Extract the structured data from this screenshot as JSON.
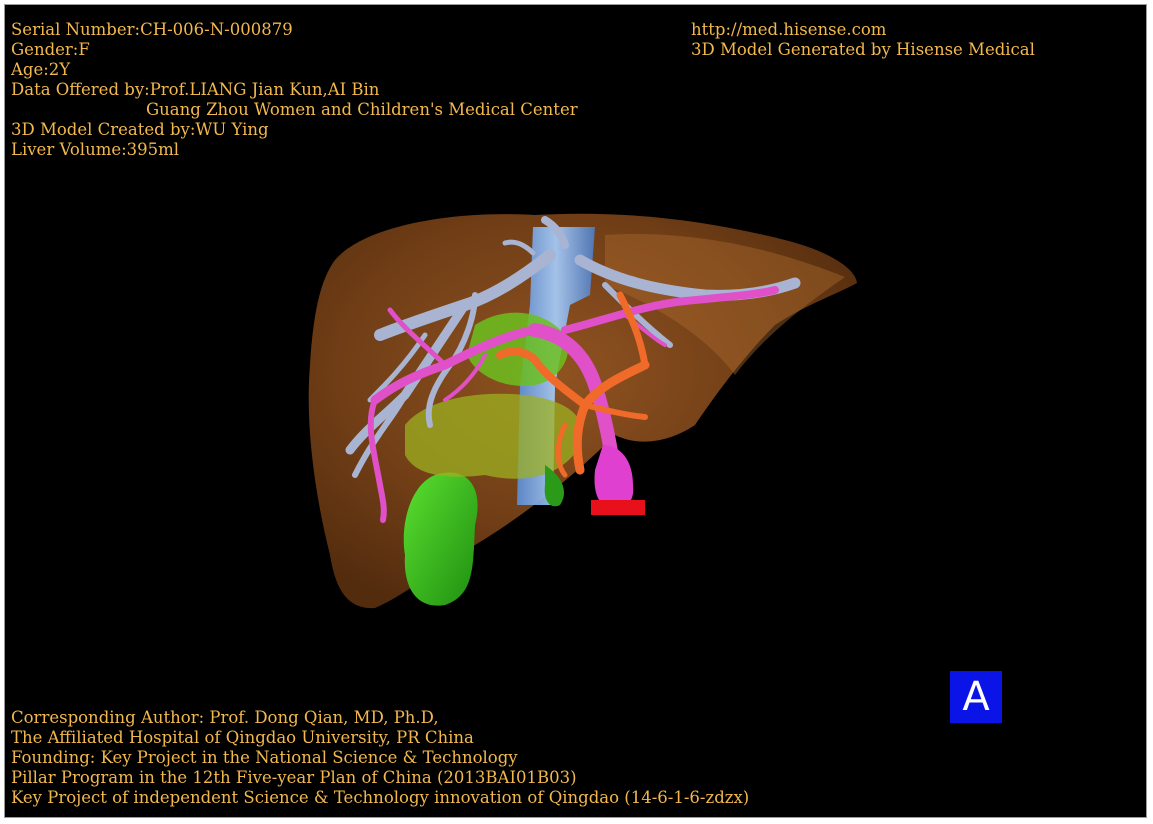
{
  "info": {
    "serial": "Serial Number:CH-006-N-000879",
    "gender": "Gender:F",
    "age": "Age:2Y",
    "data_offered": "Data Offered by:Prof.LIANG Jian Kun,AI Bin",
    "data_offered_institution": "Guang Zhou Women and Children's Medical Center",
    "model_created": "3D Model Created by:WU Ying",
    "liver_volume": "Liver Volume:395ml"
  },
  "header_right": {
    "url": "http://med.hisense.com",
    "generated_by": "3D Model Generated by Hisense Medical"
  },
  "footer": {
    "line1": "Corresponding Author: Prof. Dong Qian, MD, Ph.D,",
    "line2": "The Affiliated Hospital of Qingdao University, PR China",
    "line3": "Founding: Key Project in the National Science & Technology",
    "line4": "Pillar Program in the 12th Five-year Plan of China (2013BAI01B03)",
    "line5": "Key Project of independent Science & Technology innovation of Qingdao (14-6-1-6-zdzx)"
  },
  "view_label": "A",
  "colors": {
    "text": "#f2b84d",
    "background": "#000000",
    "liver": "#8a4c1c",
    "hepatic_vein": "#a9b4d2",
    "portal_vein": "#e050c8",
    "artery": "#f06a2a",
    "gallbladder": "#3cc81e",
    "ivc": "#86b8f0",
    "label_bg": "#0a14e6"
  }
}
